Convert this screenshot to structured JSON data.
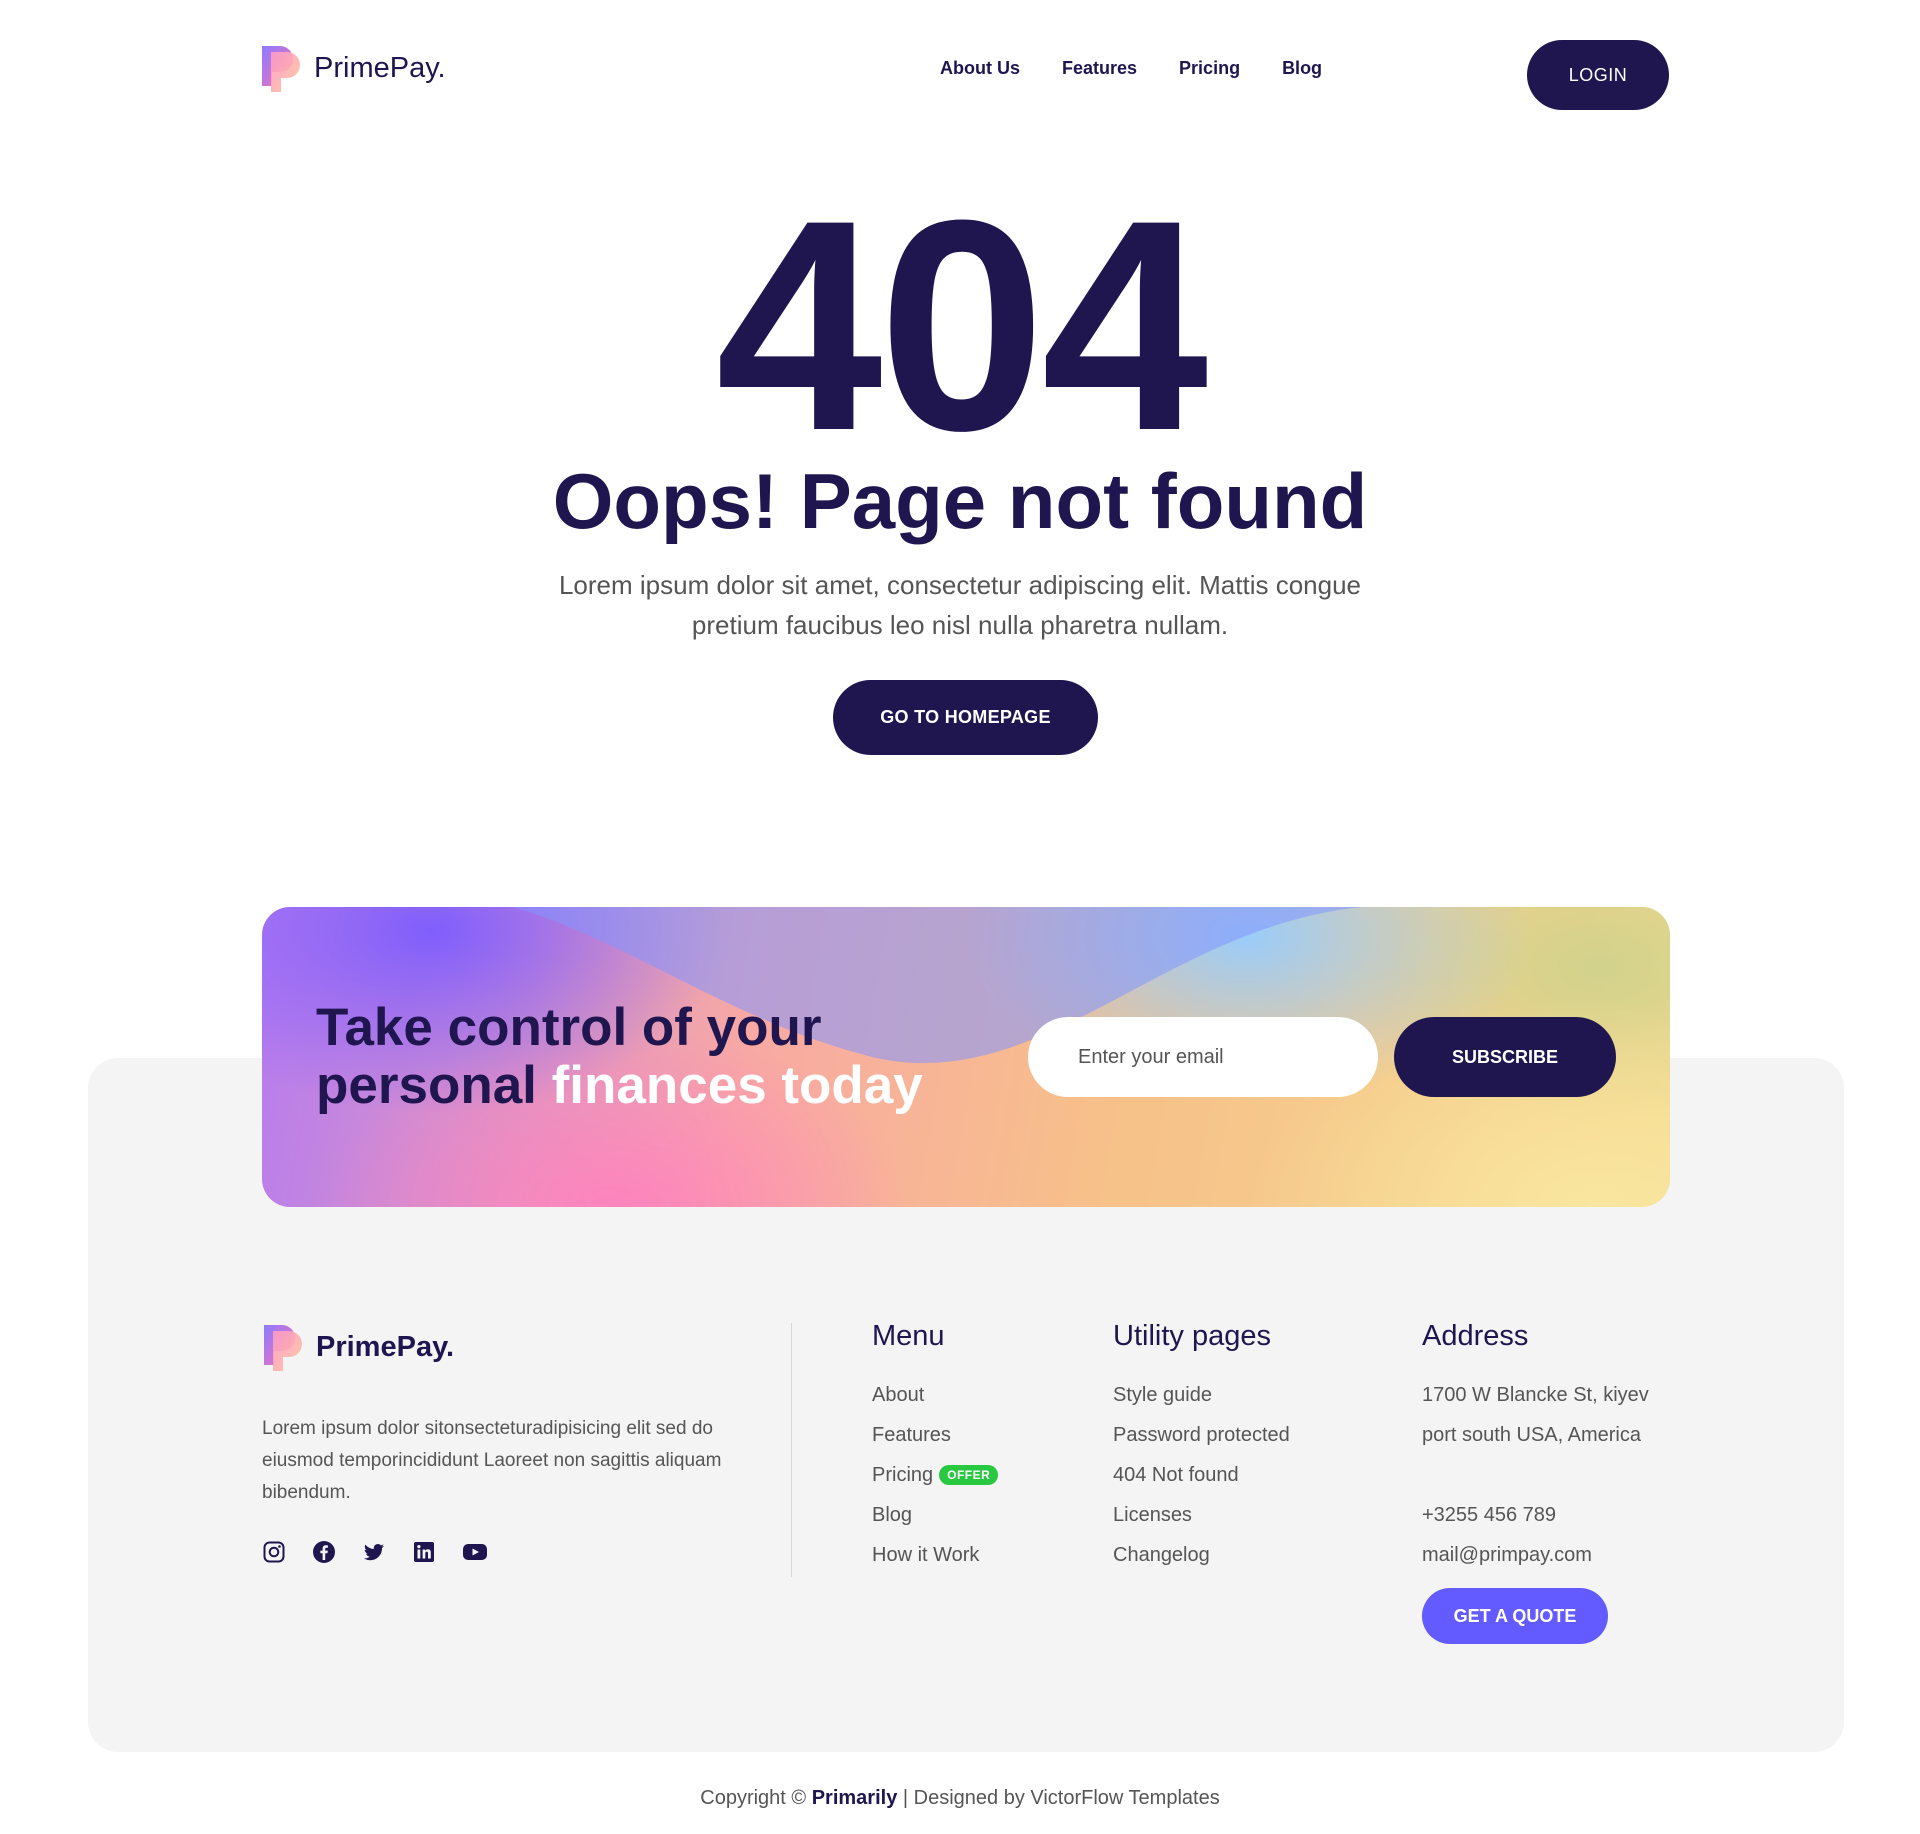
{
  "brand": {
    "name": "PrimePay."
  },
  "header": {
    "nav": [
      {
        "label": "About Us"
      },
      {
        "label": "Features"
      },
      {
        "label": "Pricing"
      },
      {
        "label": "Blog"
      }
    ],
    "login_label": "LOGIN"
  },
  "hero": {
    "code": "404",
    "title": "Oops! Page not found",
    "description": "Lorem ipsum dolor sit amet, consectetur adipiscing elit. Mattis congue pretium faucibus leo nisl nulla pharetra nullam.",
    "button_label": "GO TO HOMEPAGE"
  },
  "cta": {
    "title_dark_1": "Take control of your",
    "title_dark_2": "personal ",
    "title_light": "finances today",
    "email_placeholder": "Enter your email",
    "subscribe_label": "SUBSCRIBE"
  },
  "footer": {
    "about": "Lorem ipsum dolor sitonsecteturadipisicing elit sed do eiusmod temporincididunt Laoreet non sagittis aliquam bibendum.",
    "socials": [
      "instagram-icon",
      "facebook-icon",
      "twitter-icon",
      "linkedin-icon",
      "youtube-icon"
    ],
    "menu": {
      "heading": "Menu",
      "items": [
        "About",
        "Features",
        "Pricing",
        "Blog",
        "How it Work"
      ],
      "badge": "OFFER"
    },
    "utility": {
      "heading": "Utility pages",
      "items": [
        "Style guide",
        "Password protected",
        "404 Not found",
        "Licenses",
        "Changelog"
      ]
    },
    "address": {
      "heading": "Address",
      "line1": "1700 W Blancke St, kiyev",
      "line2": "port south USA, America",
      "phone": "+3255 456 789",
      "email": "mail@primpay.com",
      "quote_label": "GET A QUOTE"
    }
  },
  "copyright": {
    "prefix": "Copyright © ",
    "brand": "Primarily",
    "suffix": " | Designed by VictorFlow Templates"
  },
  "colors": {
    "primary": "#1f1650",
    "accent": "#635bff",
    "badge": "#28c840",
    "footer_bg": "#f4f4f5"
  }
}
